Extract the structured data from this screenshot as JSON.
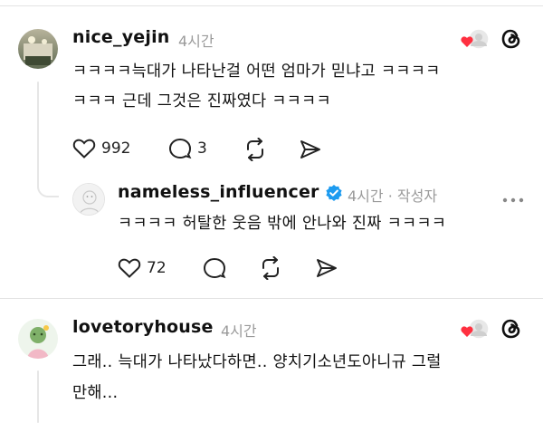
{
  "comments": [
    {
      "username": "nice_yejin",
      "time": "4시간",
      "text_lines": [
        "ㅋㅋㅋㅋ늑대가 나타난걸 어떤 엄마가 믿냐고 ㅋㅋㅋㅋ",
        "ㅋㅋㅋ 근데 그것은 진짜였다 ㅋㅋㅋㅋ"
      ],
      "likes": "992",
      "replies": "3"
    },
    {
      "username": "nameless_influencer",
      "time": "4시간 · 작성자",
      "verified": true,
      "text_lines": [
        "ㅋㅋㅋㅋ 허탈한 웃음 밖에 안나와 진짜 ㅋㅋㅋㅋ"
      ],
      "likes": "72"
    },
    {
      "username": "lovetoryhouse",
      "time": "4시간",
      "text_lines": [
        "그래.. 늑대가 나타났다하면.. 양치기소년도아니규 그럴",
        "만해..."
      ]
    }
  ],
  "icons": {
    "like": "heart-icon",
    "reply": "comment-icon",
    "repost": "repost-icon",
    "share": "send-icon",
    "more": "more-icon",
    "threads": "threads-logo-icon"
  },
  "colors": {
    "verified": "#1d9bf0",
    "heart_badge": "#ff3040",
    "muted": "#9a9a9a"
  }
}
